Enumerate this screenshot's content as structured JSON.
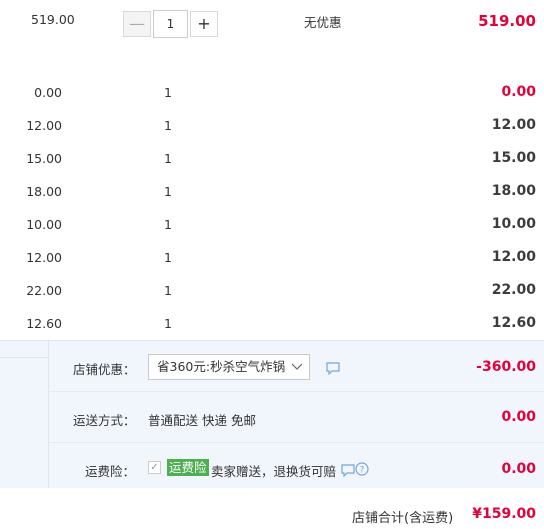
{
  "main_item": {
    "unit_price": "519.00",
    "quantity": "1",
    "discount": "无优惠",
    "subtotal": "519.00",
    "minus_label": "—",
    "plus_label": "+"
  },
  "addons": [
    {
      "unit_price": "0.00",
      "quantity": "1",
      "subtotal": "0.00",
      "subtotal_color": "#e4003a"
    },
    {
      "unit_price": "12.00",
      "quantity": "1",
      "subtotal": "12.00"
    },
    {
      "unit_price": "15.00",
      "quantity": "1",
      "subtotal": "15.00"
    },
    {
      "unit_price": "18.00",
      "quantity": "1",
      "subtotal": "18.00"
    },
    {
      "unit_price": "10.00",
      "quantity": "1",
      "subtotal": "10.00"
    },
    {
      "unit_price": "12.00",
      "quantity": "1",
      "subtotal": "12.00"
    },
    {
      "unit_price": "22.00",
      "quantity": "1",
      "subtotal": "22.00"
    },
    {
      "unit_price": "12.60",
      "quantity": "1",
      "subtotal": "12.60"
    }
  ],
  "shop_discount": {
    "label": "店铺优惠：",
    "selected": "省360元:秒杀空气炸锅",
    "amount": "-360.00"
  },
  "shipping": {
    "label": "运送方式：",
    "method": "普通配送 快递 免邮",
    "amount": "0.00"
  },
  "shipping_insurance": {
    "label": "运费险：",
    "badge": "运费险",
    "desc": "卖家赠送，退换货可赔",
    "amount": "0.00"
  },
  "total": {
    "label": "店铺合计(含运费)",
    "amount": "¥159.00"
  },
  "colors": {
    "accent_red": "#e4003a",
    "summary_bg": "#f1f6fd",
    "badge_green": "#4caf50"
  }
}
